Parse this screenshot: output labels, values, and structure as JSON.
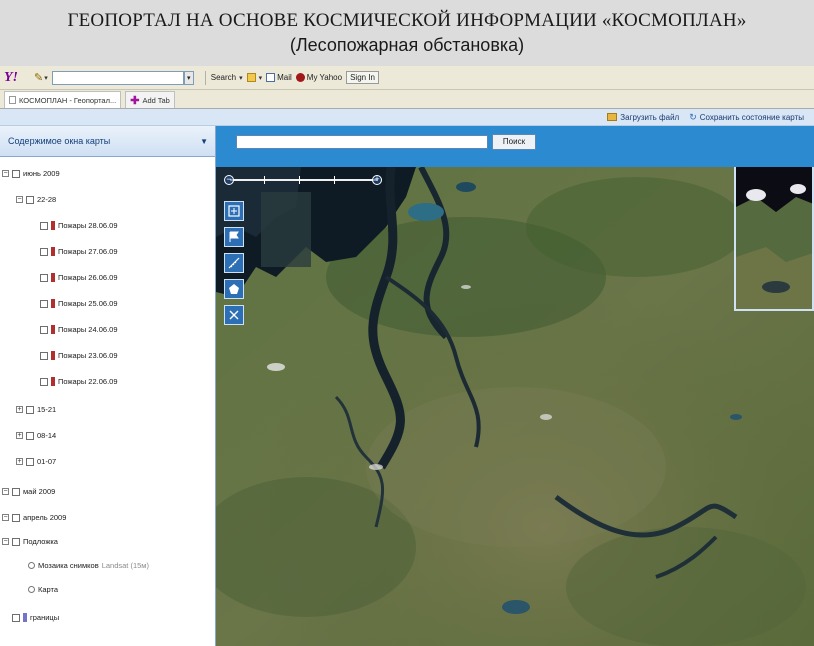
{
  "slide": {
    "title": "ГЕОПОРТАЛ НА ОСНОВЕ КОСМИЧЕСКОЙ ИНФОРМАЦИИ «КОСМОПЛАН»",
    "subtitle": "(Лесопожарная обстановка)"
  },
  "toolbar": {
    "search_label": "Search",
    "mail_label": "Mail",
    "myyahoo_label": "My Yahoo",
    "signin_label": "Sign In"
  },
  "tabs": [
    {
      "label": "КОСМОПЛАН - Геопортал..."
    },
    {
      "label": "Add Tab"
    }
  ],
  "app_top": {
    "upload_label": "Загрузить файл",
    "save_state_label": "Сохранить состояние карты"
  },
  "panel": {
    "header": "Содержимое окна карты",
    "tree": {
      "group_2009": "июнь 2009",
      "sub_22_28": "22-28",
      "layers": [
        "Пожары 28.06.09",
        "Пожары 27.06.09",
        "Пожары 26.06.09",
        "Пожары 25.06.09",
        "Пожары 24.06.09",
        "Пожары 23.06.09",
        "Пожары 22.06.09"
      ],
      "sub_15_21": "15-21",
      "sub_08_14": "08-14",
      "sub_01_07": "01-07",
      "group_may": "май 2009",
      "group_april": "апрель 2009",
      "group_base": "Подложка",
      "base_mosaic": "Мозаика снимков",
      "base_mosaic_note": "Landsat (15м)",
      "base_map": "Карта",
      "group_borders": "границы"
    }
  },
  "search": {
    "value": "",
    "button_label": "Поиск"
  },
  "colors": {
    "accent_blue": "#2c8ad0",
    "fire_layer": "#b03030",
    "border_layer": "#7474c8"
  },
  "icons": {
    "tools": [
      "zoom-extent-icon",
      "flag-icon",
      "measure-icon",
      "polygon-icon",
      "clear-icon"
    ]
  }
}
